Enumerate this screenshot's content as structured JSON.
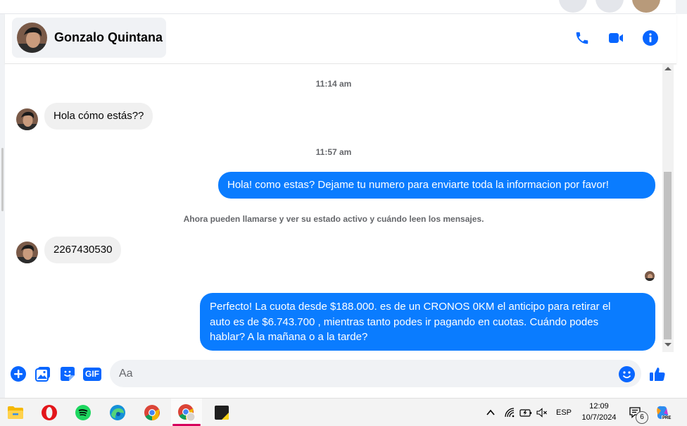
{
  "header": {
    "contact_name": "Gonzalo Quintana"
  },
  "thread": {
    "timestamp_1": "11:14 am",
    "timestamp_2": "11:57 am",
    "messages": [
      {
        "from": "contact",
        "text": "Hola cómo estás??"
      },
      {
        "from": "me",
        "text": "Hola! como estas? Dejame tu numero para enviarte toda la informacion por favor!"
      },
      {
        "from": "contact",
        "text": "2267430530"
      },
      {
        "from": "me",
        "lines": [
          "Perfecto! La cuota desde $188.000. es de un CRONOS 0KM el anticipo para retirar el",
          "auto es de $6.743.700 , mientras tanto podes ir pagando en cuotas. Cuándo podes",
          "hablar? A la mañana o a la tarde?"
        ]
      }
    ],
    "notice": "Ahora pueden llamarse y ver su estado activo y cuándo leen los mensajes."
  },
  "composer": {
    "placeholder": "Aa",
    "gif_label": "GIF"
  },
  "taskbar": {
    "language": "ESP",
    "time": "12:09",
    "date": "10/7/2024",
    "notification_count": "6",
    "copilot_badge": "PRE"
  },
  "colors": {
    "messenger_blue": "#0a7cff",
    "icon_blue": "#0866ff",
    "incoming_bubble": "#f0f0f0"
  }
}
